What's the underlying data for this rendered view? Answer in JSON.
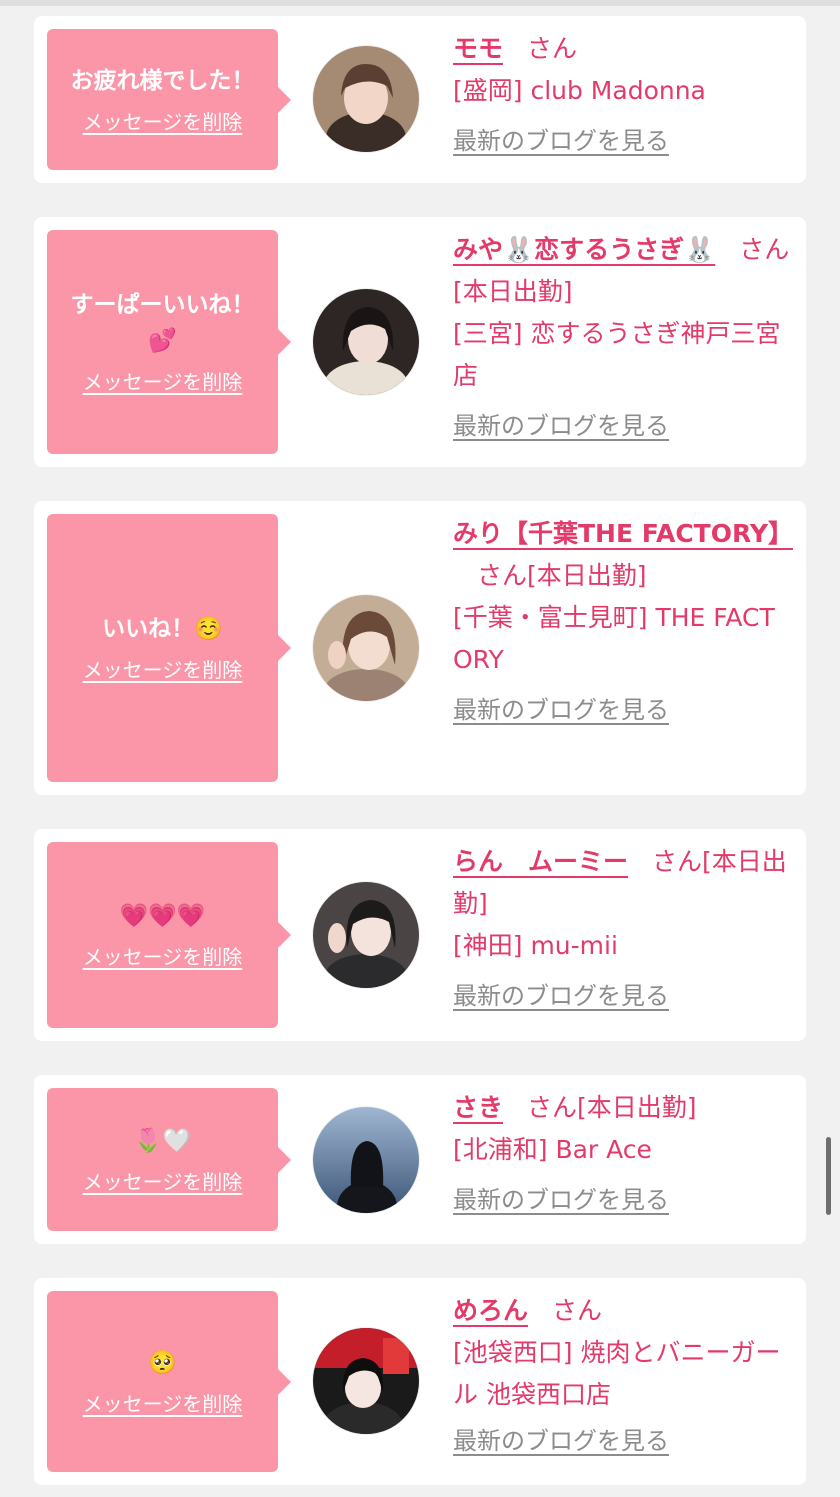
{
  "delete_label": "メッセージを削除",
  "blog_label": "最新のブログを見る",
  "accent_color": "#e33a6a",
  "bubble_color": "#fb96a8",
  "items": [
    {
      "message": "お疲れ様でした！",
      "name": "モモ",
      "san": "さん",
      "status": "",
      "shop": "[盛岡] club Madonna"
    },
    {
      "message": "すーぱーいいね！💕",
      "name": "みや🐰恋するうさぎ🐰",
      "san": "さん",
      "status": "[本日出勤]",
      "shop": "[三宮] 恋するうさぎ神戸三宮店"
    },
    {
      "message": "いいね！☺️",
      "name": "みり【千葉THE FACTORY】",
      "san": "さん",
      "status": "[本日出勤]",
      "shop": "[千葉・富士見町] THE FACTORY"
    },
    {
      "message": "💗💗💗",
      "name": "らん　ムーミー",
      "san": "さん",
      "status": "[本日出勤]",
      "shop": "[神田] mu-mii"
    },
    {
      "message": "🌷🤍",
      "name": "さき",
      "san": "さん",
      "status": "[本日出勤]",
      "shop": "[北浦和] Bar Ace"
    },
    {
      "message": "🥺",
      "name": "めろん",
      "san": "さん",
      "status": "",
      "shop": "[池袋西口] 焼肉とバニーガール 池袋西口店"
    }
  ]
}
